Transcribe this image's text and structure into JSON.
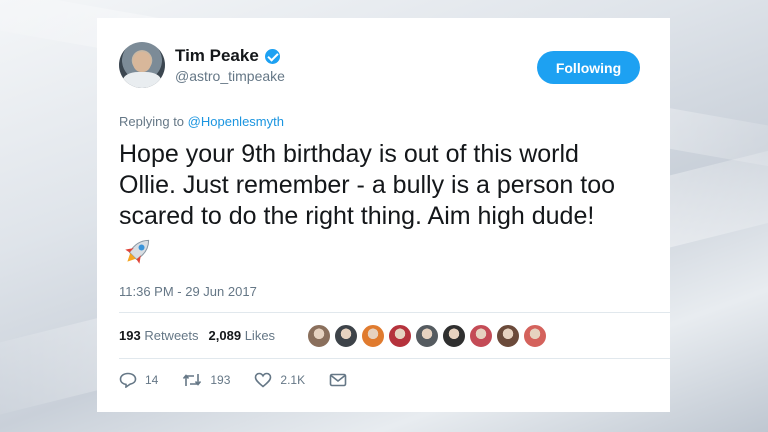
{
  "author": {
    "name": "Tim Peake",
    "handle": "@astro_timpeake",
    "follow_label": "Following"
  },
  "reply": {
    "prefix": "Replying to",
    "mention": "@Hopenlesmyth"
  },
  "tweet": {
    "line1": "Hope your 9th birthday is out of this world",
    "line2": "Ollie. Just remember - a bully is a person too",
    "line3": "scared to do the right thing. Aim high dude!",
    "emoji": "rocket-icon",
    "timestamp": "11:36 PM - 29 Jun 2017"
  },
  "stats": {
    "retweets_count": "193",
    "retweets_label": "Retweets",
    "likes_count": "2,089",
    "likes_label": "Likes",
    "liker_avatars": [
      "#8a6f5c",
      "#3d4349",
      "#e07b2f",
      "#b5323c",
      "#555b60",
      "#2f2f2f",
      "#c44b56",
      "#6b4a3a",
      "#d4625c"
    ]
  },
  "actions": {
    "reply_count": "14",
    "retweet_count": "193",
    "like_count": "2.1K"
  },
  "colors": {
    "accent": "#1da1f2",
    "link": "#1b95e0",
    "muted": "#657786",
    "text": "#14171a"
  }
}
